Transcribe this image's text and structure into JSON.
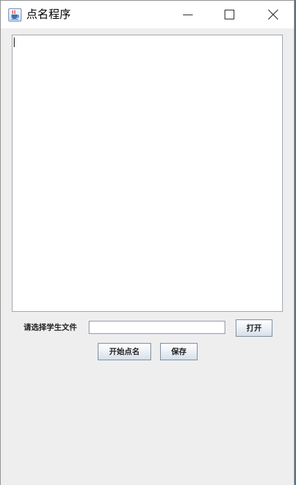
{
  "window": {
    "title": "点名程序"
  },
  "main": {
    "names_text": "",
    "file_label": "请选择学生文件",
    "file_path_value": "",
    "open_label": "打开",
    "start_label": "开始点名",
    "save_label": "保存"
  },
  "icons": {
    "app": "java-cup-icon",
    "minimize": "minimize-icon",
    "maximize": "maximize-icon",
    "close": "close-icon"
  }
}
